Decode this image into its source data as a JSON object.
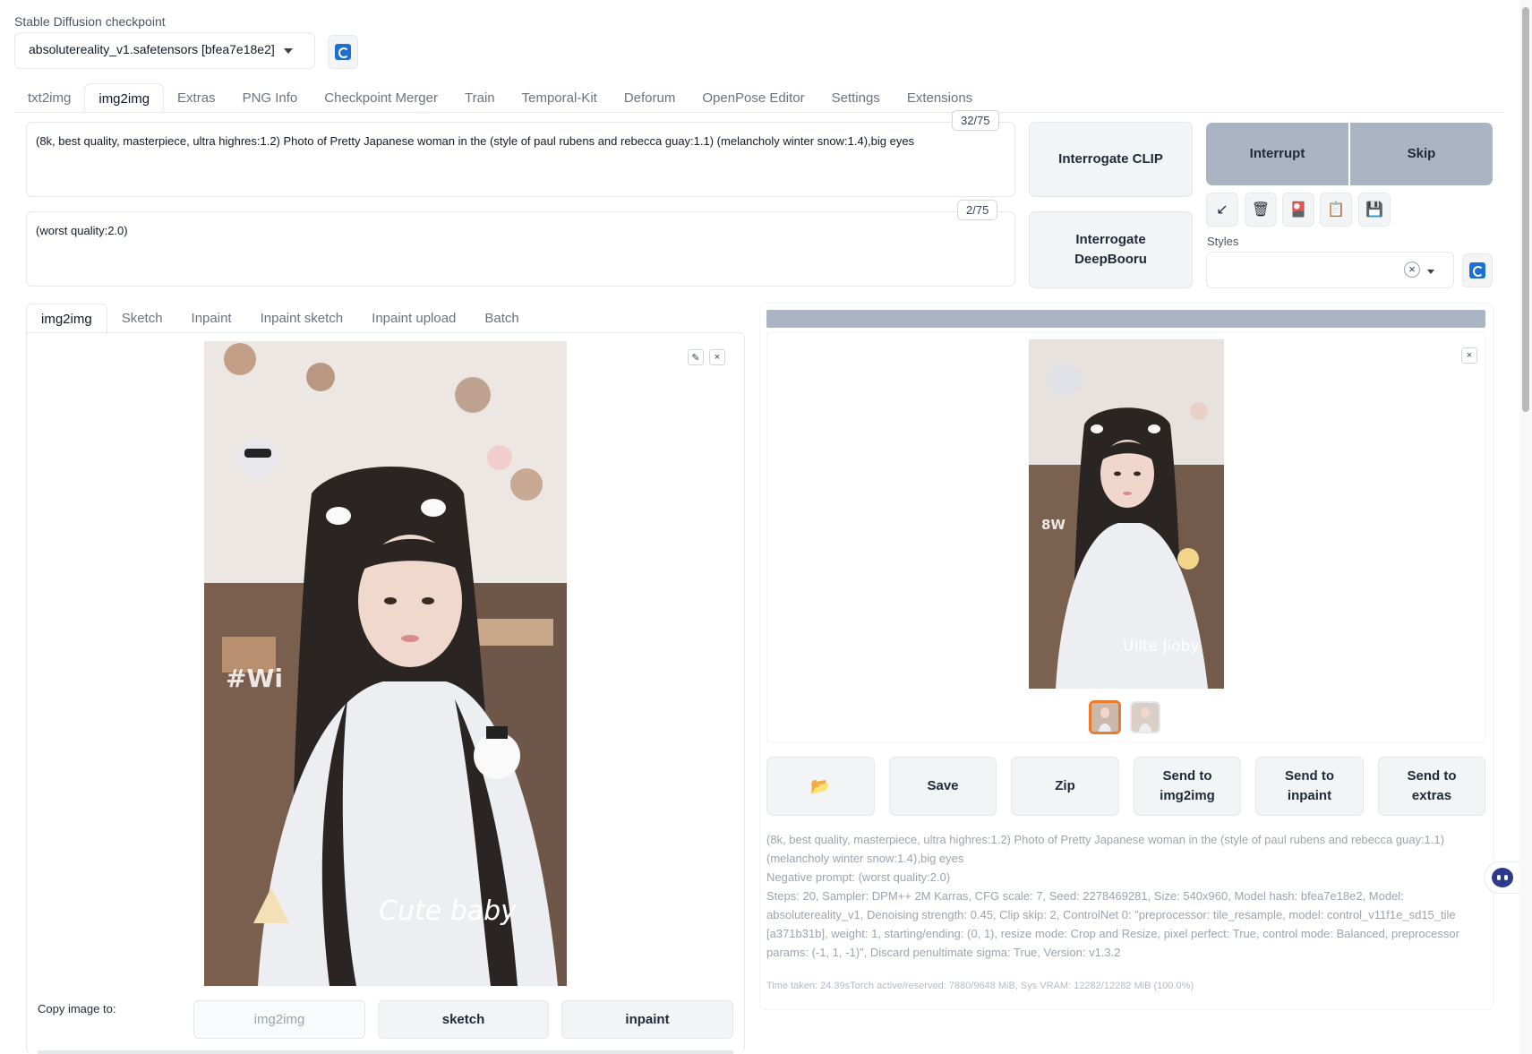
{
  "checkpoint": {
    "label": "Stable Diffusion checkpoint",
    "value": "absolutereality_v1.safetensors [bfea7e18e2]"
  },
  "tabs": [
    "txt2img",
    "img2img",
    "Extras",
    "PNG Info",
    "Checkpoint Merger",
    "Train",
    "Temporal-Kit",
    "Deforum",
    "OpenPose Editor",
    "Settings",
    "Extensions"
  ],
  "active_tab": "img2img",
  "prompt": {
    "text": "(8k, best quality, masterpiece, ultra highres:1.2) Photo of Pretty Japanese woman in the (style of paul rubens and rebecca guay:1.1) (melancholy winter snow:1.4),big eyes",
    "token_count": "32/75"
  },
  "negative_prompt": {
    "text": "(worst quality:2.0)",
    "token_count": "2/75"
  },
  "buttons": {
    "interrogate_clip": "Interrogate CLIP",
    "interrogate_deepbooru": "Interrogate DeepBooru",
    "interrupt": "Interrupt",
    "skip": "Skip"
  },
  "tools": {
    "arrow": "↙",
    "trash": "🗑",
    "card": "🎴",
    "clipboard": "📋",
    "save": "💾"
  },
  "styles": {
    "label": "Styles",
    "clear": "×"
  },
  "subtabs": [
    "img2img",
    "Sketch",
    "Inpaint",
    "Inpaint sketch",
    "Inpaint upload",
    "Batch"
  ],
  "input_image": {
    "overlay_text_1": "#Wi",
    "overlay_text_2": "Cute baby",
    "edit_icon": "✎",
    "close_icon": "×"
  },
  "copy_image": {
    "label": "Copy image to:",
    "targets": [
      "img2img",
      "sketch",
      "inpaint"
    ]
  },
  "output": {
    "close_icon": "×",
    "overlay_text_1": "8W",
    "overlay_text_2": "Uilte Jioby",
    "actions": {
      "folder": "📂",
      "save": "Save",
      "zip": "Zip",
      "send_img2img": "Send to img2img",
      "send_inpaint": "Send to inpaint",
      "send_extras": "Send to extras"
    },
    "info_prompt": "(8k, best quality, masterpiece, ultra highres:1.2) Photo of Pretty Japanese woman in the (style of paul rubens and rebecca guay:1.1) (melancholy winter snow:1.4),big eyes",
    "info_negative": "Negative prompt: (worst quality:2.0)",
    "info_params": "Steps: 20, Sampler: DPM++ 2M Karras, CFG scale: 7, Seed: 2278469281, Size: 540x960, Model hash: bfea7e18e2, Model: absolutereality_v1, Denoising strength: 0.45, Clip skip: 2, ControlNet 0: \"preprocessor: tile_resample, model: control_v11f1e_sd15_tile [a371b31b], weight: 1, starting/ending: (0, 1), resize mode: Crop and Resize, pixel perfect: True, control mode: Balanced, preprocessor params: (-1, 1, -1)\", Discard penultimate sigma: True, Version: v1.3.2",
    "time_taken": "Time taken: 24.39sTorch active/reserved: 7880/9648 MiB, Sys VRAM: 12282/12282 MiB (100.0%)"
  },
  "colors": {
    "accent_orange": "#ea7a2c",
    "gray_button": "#aab4c2",
    "refresh_blue": "#1e6fd1"
  }
}
